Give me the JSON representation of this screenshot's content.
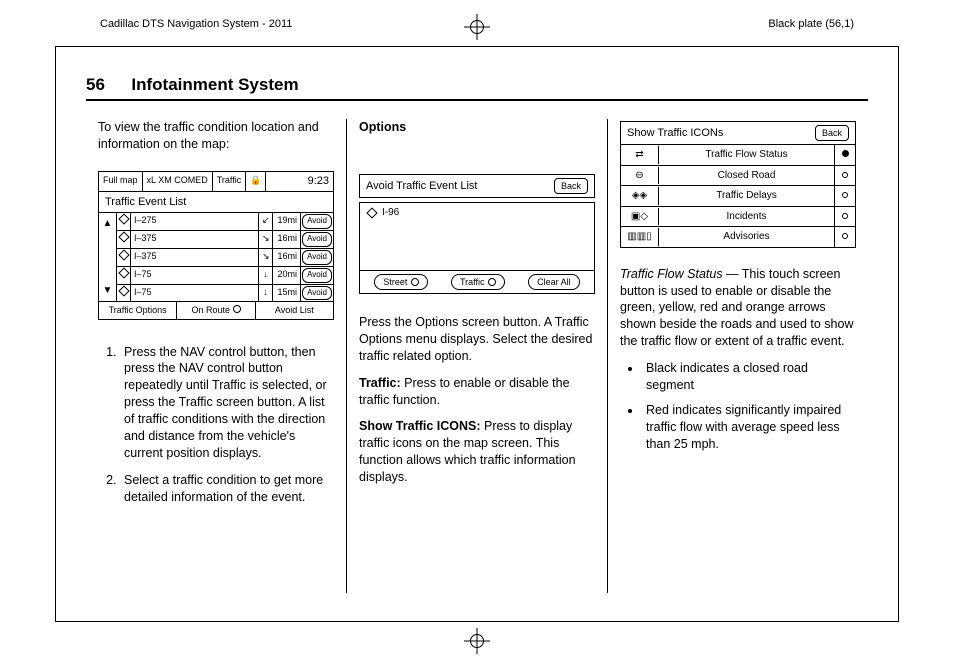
{
  "top": {
    "left": "Cadillac DTS Navigation System - 2011",
    "right": "Black plate (56,1)"
  },
  "header": {
    "page": "56",
    "chapter": "Infotainment System"
  },
  "col1": {
    "intro": "To view the traffic condition location and information on the map:",
    "fig": {
      "topbar": {
        "a": "Full map",
        "b": "xL XM COMED",
        "c": "Traffic",
        "time": "9:23"
      },
      "title": "Traffic Event List",
      "rows": [
        {
          "road": "I–275",
          "dist": "19mi",
          "avoid": "Avoid"
        },
        {
          "road": "I–375",
          "dist": "16mi",
          "avoid": "Avoid"
        },
        {
          "road": "I–375",
          "dist": "16mi",
          "avoid": "Avoid"
        },
        {
          "road": "I–75",
          "dist": "20mi",
          "avoid": "Avoid"
        },
        {
          "road": "I–75",
          "dist": "15mi",
          "avoid": "Avoid"
        }
      ],
      "bottom": {
        "a": "Traffic Options",
        "b": "On Route",
        "c": "Avoid List"
      }
    },
    "step1": "Press the NAV control button, then press the NAV control button repeatedly until Traffic is selected, or press the Traffic screen button. A list of traffic conditions with the direction and distance from the vehicle's current position displays.",
    "step2": "Select a traffic condition to get more detailed information of the event."
  },
  "col2": {
    "h": "Options",
    "fig": {
      "title": "Avoid Traffic Event List",
      "back": "Back",
      "item": "I-96",
      "b1": "Street",
      "b2": "Traffic",
      "b3": "Clear All"
    },
    "p1": "Press the Options screen button. A Traffic Options menu displays. Select the desired traffic related option.",
    "p2a": "Traffic:",
    "p2b": "  Press to enable or disable the traffic function.",
    "p3a": "Show Traffic ICONS:",
    "p3b": "  Press to display traffic icons on the map screen. This function allows which traffic information displays."
  },
  "col3": {
    "fig": {
      "title": "Show Traffic ICONs",
      "back": "Back",
      "rows": [
        {
          "label": "Traffic Flow Status",
          "on": true
        },
        {
          "label": "Closed Road",
          "on": false
        },
        {
          "label": "Traffic Delays",
          "on": false
        },
        {
          "label": "Incidents",
          "on": false
        },
        {
          "label": "Advisories",
          "on": false
        }
      ]
    },
    "p1a": "Traffic Flow Status",
    "p1b": " — This touch screen button is used to enable or disable the green, yellow, red and orange arrows shown beside the roads and used to show the traffic flow or extent of a traffic event.",
    "b1": "Black indicates a closed road segment",
    "b2": "Red indicates significantly impaired traffic flow with average speed less than 25 mph."
  }
}
